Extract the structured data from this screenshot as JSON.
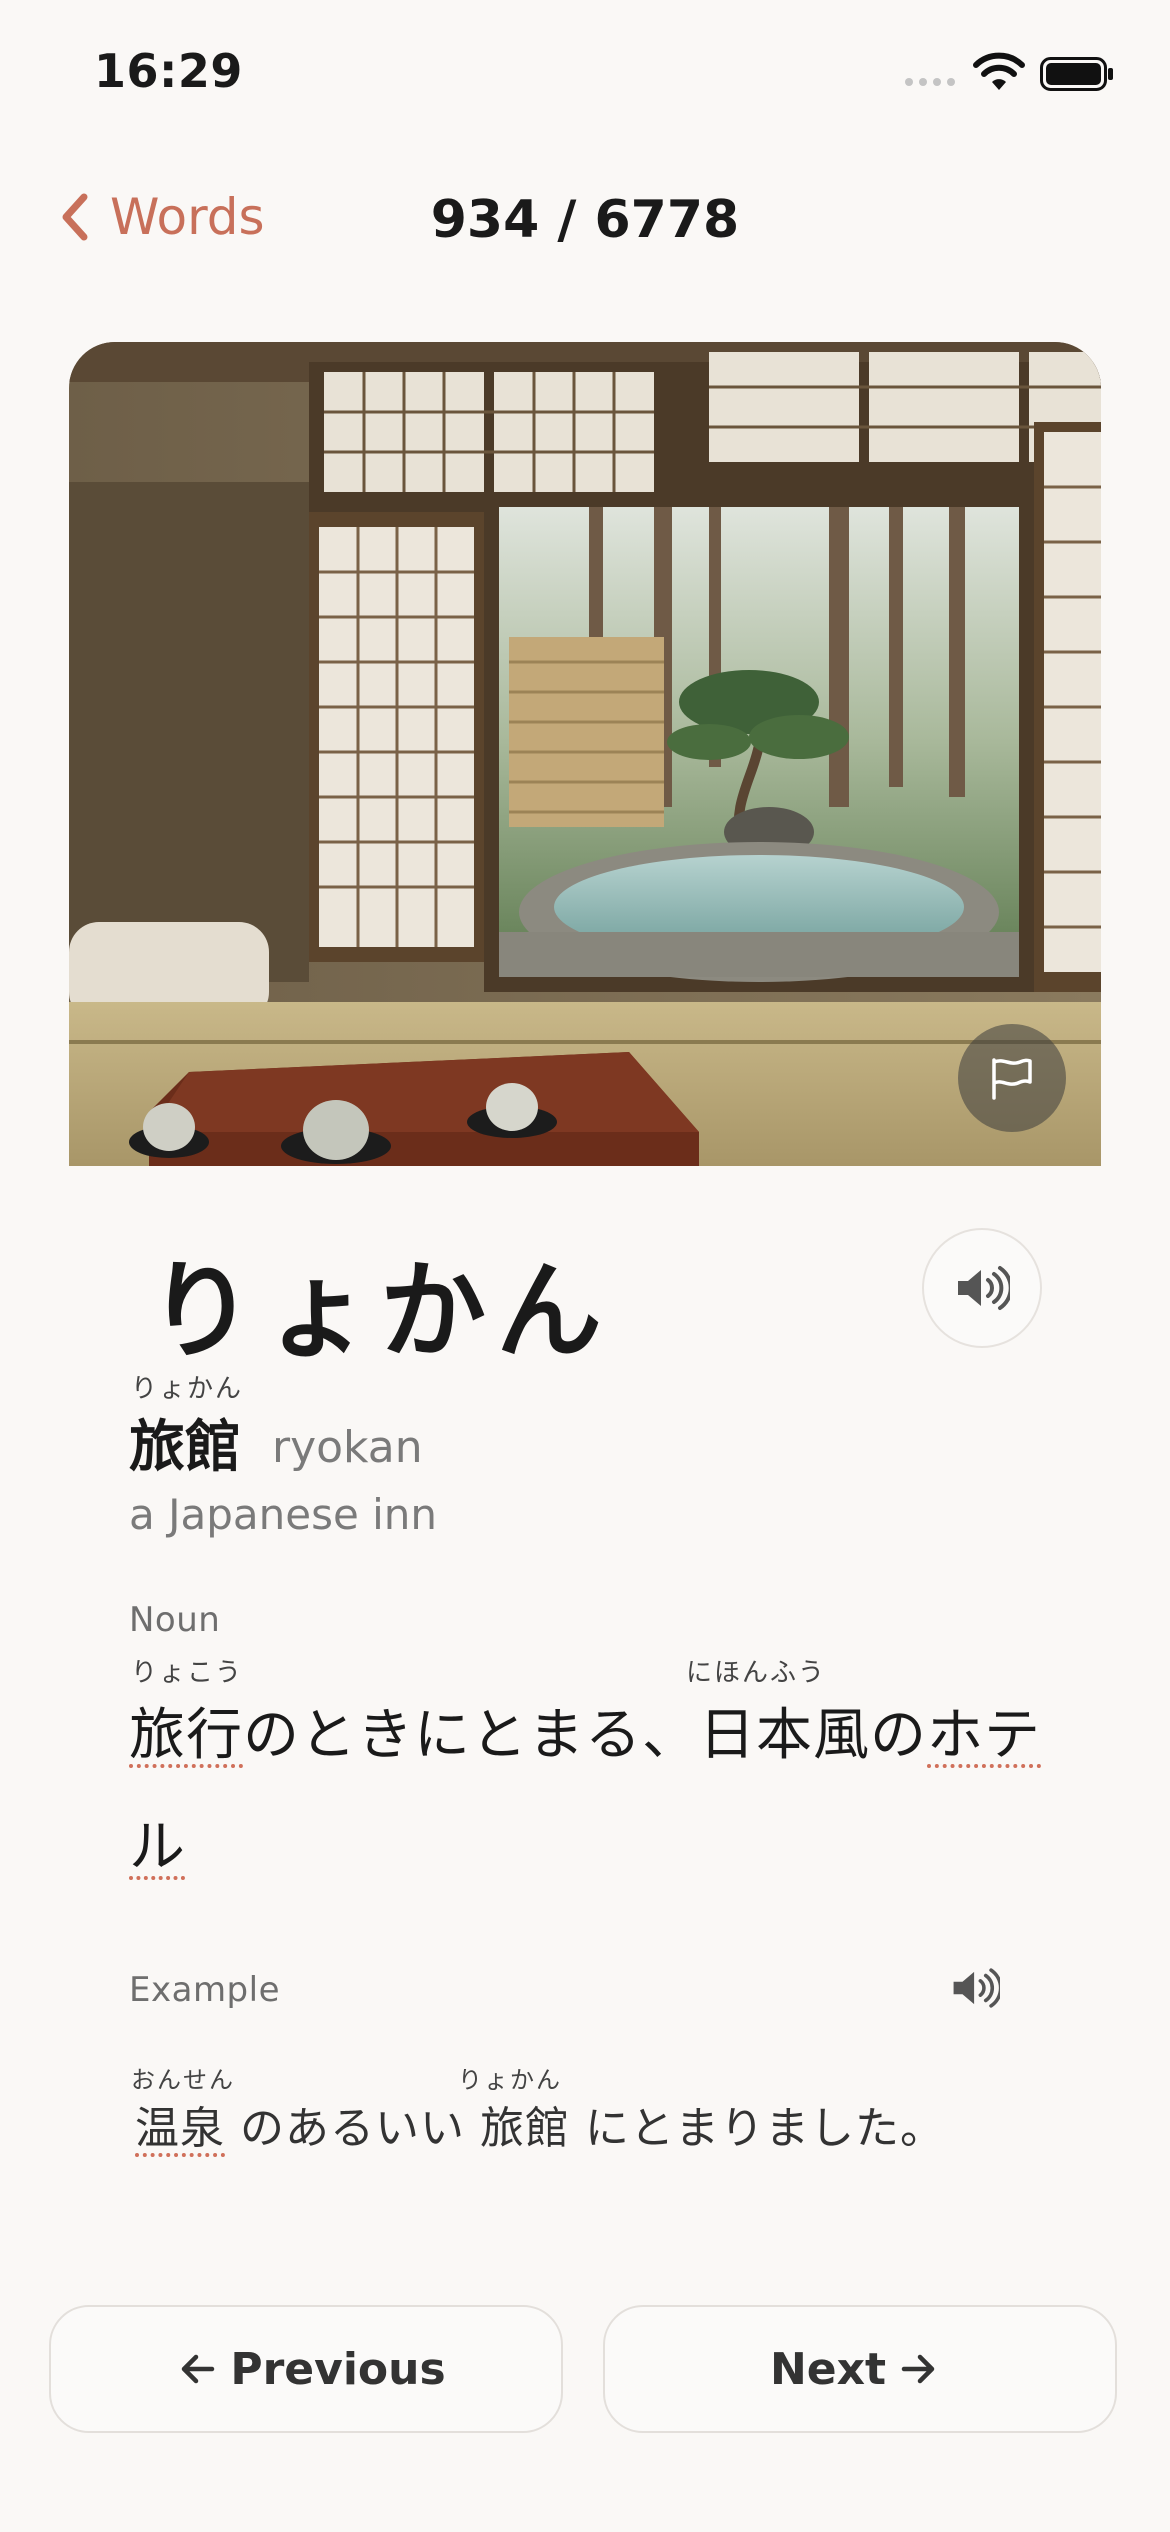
{
  "status_bar": {
    "time": "16:29"
  },
  "nav": {
    "back_label": "Words",
    "counter": "934 / 6778"
  },
  "word": {
    "kana": "りょかん",
    "kanji_ruby": "りょかん",
    "kanji": "旅館",
    "romaji": "ryokan",
    "meaning": "a Japanese inn"
  },
  "definition": {
    "part_of_speech": "Noun",
    "ruby_1": "りょこう",
    "ruby_2": "にほんふう",
    "seg_ryokou": "旅行",
    "seg_mid": "のときにとまる、日本風の",
    "seg_hote": "ホテ",
    "seg_ru": "ル"
  },
  "example": {
    "label": "Example",
    "ruby_1": "おんせん",
    "ruby_2": "りょかん",
    "seg_onsen": "温泉",
    "seg_mid": " のあるいい ",
    "seg_ryokan": "旅館",
    "seg_end": " にとまりました。"
  },
  "buttons": {
    "previous": "Previous",
    "next": "Next"
  },
  "icons": {
    "back": "chevron-left-icon",
    "flag": "flag-icon",
    "audio": "speaker-icon",
    "example_audio": "speaker-icon",
    "prev_arrow": "arrow-left-icon",
    "next_arrow": "arrow-right-icon"
  },
  "colors": {
    "accent": "#c8705a",
    "background": "#faf8f6",
    "text": "#1a1a1a",
    "muted": "#7a7a7a"
  }
}
